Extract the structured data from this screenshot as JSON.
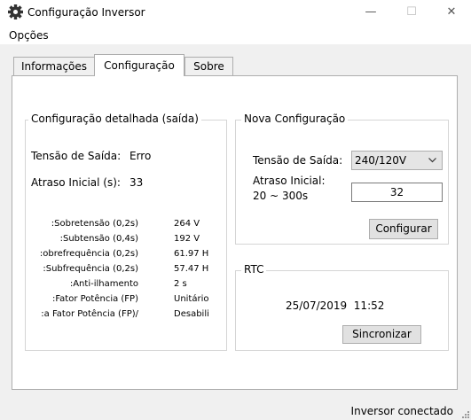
{
  "window": {
    "title": "Configuração Inversor",
    "minimize": "—",
    "maximize": "☐",
    "close": "✕",
    "icon": "gear-icon"
  },
  "menu": {
    "options": "Opções"
  },
  "tabs": [
    {
      "label": "Informações",
      "active": false
    },
    {
      "label": "Configuração",
      "active": true
    },
    {
      "label": "Sobre",
      "active": false
    }
  ],
  "detail_group": {
    "title": "Configuração detalhada (saída)",
    "voltage_label": "Tensão de Saída:",
    "voltage_value": "Erro",
    "delay_label": "Atraso Inicial (s):",
    "delay_value": "33",
    "params": [
      {
        "label": "Sobretensão (0,2s):",
        "value": "264 V"
      },
      {
        "label": "Subtensão (0,4s):",
        "value": "192 V"
      },
      {
        "label": "obrefrequência (0,2s):",
        "value": "61.97 H"
      },
      {
        "label": "Subfrequência (0,2s):",
        "value": "57.47 H"
      },
      {
        "label": "Anti-ilhamento:",
        "value": "2 s"
      },
      {
        "label": "Fator Potência (FP):",
        "value": "Unitário"
      },
      {
        "label": "/a Fator Potência (FP):",
        "value": "Desabilit"
      }
    ]
  },
  "new_config_group": {
    "title": "Nova Configuração",
    "voltage_label": "Tensão de Saída:",
    "voltage_selected": "240/120V",
    "delay_label_line1": "Atraso Inicial:",
    "delay_label_line2": "20 ~ 300s",
    "delay_value": "32",
    "configure_button": "Configurar"
  },
  "rtc_group": {
    "title": "RTC",
    "datetime": "25/07/2019  11:52",
    "sync_button": "Sincronizar"
  },
  "status": {
    "text": "Inversor conectado"
  }
}
